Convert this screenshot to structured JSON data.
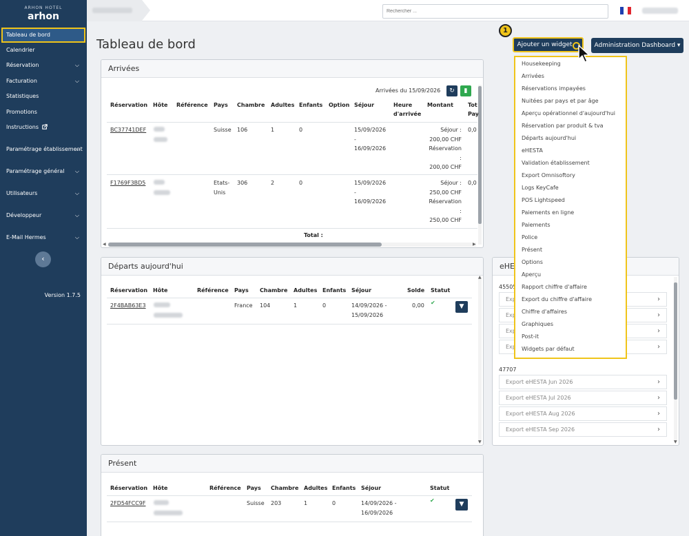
{
  "brand": {
    "mark": "ARHON HOTEL",
    "word": "arhon"
  },
  "sidebar": {
    "items": [
      {
        "label": "Tableau de bord",
        "chevron": false,
        "active": true
      },
      {
        "label": "Calendrier",
        "chevron": false
      },
      {
        "label": "Réservation",
        "chevron": true
      },
      {
        "label": "Facturation",
        "chevron": true
      },
      {
        "label": "Statistiques",
        "chevron": false
      },
      {
        "label": "Promotions",
        "chevron": false
      },
      {
        "label": "Instructions",
        "chevron": false,
        "external": true
      },
      {
        "label": "Paramétrage établissement",
        "chevron": true
      },
      {
        "label": "Paramétrage général",
        "chevron": true
      },
      {
        "label": "Utilisateurs",
        "chevron": true
      },
      {
        "label": "Développeur",
        "chevron": true
      },
      {
        "label": "E-Mail Hermes",
        "chevron": true
      }
    ],
    "collapse_icon": "‹",
    "version": "Version 1.7.5"
  },
  "topbar": {
    "search_placeholder": "Rechercher ...",
    "language": "fr"
  },
  "page": {
    "title": "Tableau de bord",
    "add_widget_label": "Ajouter un widget",
    "admin_dashboard_label": "Administration Dashboard ▾",
    "step_badge": "1"
  },
  "arrivals": {
    "title": "Arrivées",
    "date_label": "Arrivées du 15/09/2026",
    "headers": [
      "Réservation",
      "Hôte",
      "Référence",
      "Pays",
      "Chambre",
      "Adultes",
      "Enfants",
      "Option",
      "Séjour",
      "Heure d'arrivée",
      "Montant",
      "Tot Pay"
    ],
    "rows": [
      {
        "reservation": "BC37741DEF",
        "country": "Suisse",
        "room": "106",
        "adults": "1",
        "children": "0",
        "stay_from": "15/09/2026",
        "stay_sep": "-",
        "stay_to": "16/09/2026",
        "amount_l1": "Séjour :",
        "amount_l2": "200,00 CHF",
        "amount_l3": "Réservation",
        "amount_l4": ":",
        "amount_l5": "200,00 CHF",
        "total": "0,0"
      },
      {
        "reservation": "F1769F3BD5",
        "country": "Etats-Unis",
        "room": "306",
        "adults": "2",
        "children": "0",
        "stay_from": "15/09/2026",
        "stay_sep": "-",
        "stay_to": "16/09/2026",
        "amount_l1": "Séjour :",
        "amount_l2": "250,00 CHF",
        "amount_l3": "Réservation",
        "amount_l4": ":",
        "amount_l5": "250,00 CHF",
        "total": "0,0"
      }
    ],
    "total_label": "Total :"
  },
  "departures": {
    "title": "Départs aujourd'hui",
    "headers": [
      "Réservation",
      "Hôte",
      "Référence",
      "Pays",
      "Chambre",
      "Adultes",
      "Enfants",
      "Séjour",
      "Solde",
      "Statut"
    ],
    "rows": [
      {
        "reservation": "2F4BAB63E3",
        "country": "France",
        "room": "104",
        "adults": "1",
        "children": "0",
        "stay": "14/09/2026 -",
        "stay2": "15/09/2026",
        "balance": "0,00",
        "status": "✔"
      }
    ]
  },
  "present": {
    "title": "Présent",
    "headers": [
      "Réservation",
      "Hôte",
      "Référence",
      "Pays",
      "Chambre",
      "Adultes",
      "Enfants",
      "Séjour",
      "Statut"
    ],
    "rows": [
      {
        "reservation": "2FD54FCC9F",
        "country": "Suisse",
        "room": "203",
        "adults": "1",
        "children": "0",
        "stay": "14/09/2026 -",
        "stay2": "16/09/2026",
        "status": "✔"
      }
    ]
  },
  "ehesta": {
    "title": "eHE",
    "group1": {
      "id": "45505",
      "items": [
        "Exp",
        "Exp",
        "Exp",
        "Exp"
      ]
    },
    "group2": {
      "id": "47707",
      "items": [
        "Export eHESTA Jun 2026",
        "Export eHESTA Jul 2026",
        "Export eHESTA Aug 2026",
        "Export eHESTA Sep 2026"
      ]
    }
  },
  "widget_menu": {
    "items": [
      "Housekeeping",
      "Arrivées",
      "Réservations impayées",
      "Nuitées par pays et par âge",
      "Aperçu opérationnel d'aujourd'hui",
      "Réservation par produit & tva",
      "Départs aujourd'hui",
      "eHESTA",
      "Validation établissement",
      "Export Omnisoftory",
      "Logs KeyCafe",
      "POS Lightspeed",
      "Paiements en ligne",
      "Paiements",
      "Police",
      "Présent",
      "Options",
      "Aperçu",
      "Rapport chiffre d'affaire",
      "Export du chiffre d'affaire",
      "Chiffre d'affaires",
      "Graphiques",
      "Post-it",
      "Widgets par défaut"
    ]
  },
  "colors": {
    "sidebar": "#1f3d5c",
    "accent_highlight": "#f0c419",
    "button": "#1f3d5c",
    "status_ok": "#2fa84f"
  }
}
